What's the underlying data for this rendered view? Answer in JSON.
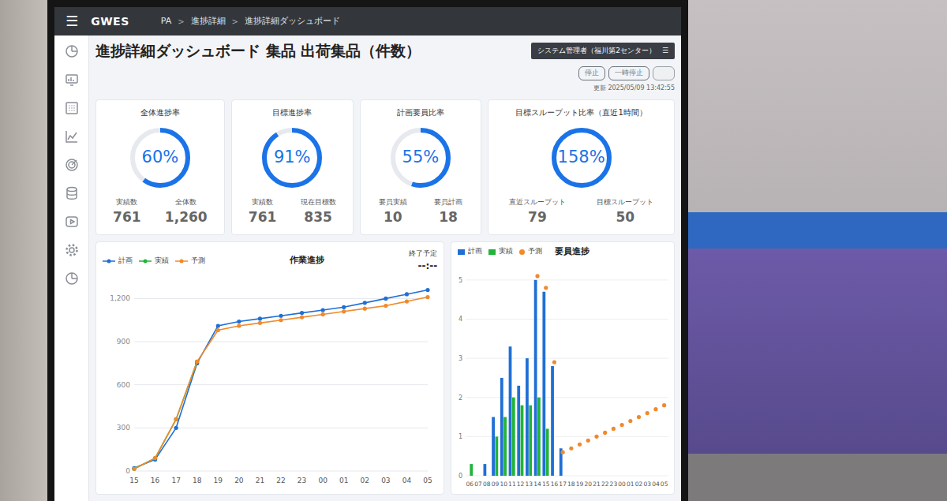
{
  "header": {
    "menu_icon": "☰",
    "logo": "GWES",
    "breadcrumbs": [
      "PA",
      "進捗詳細",
      "進捗詳細ダッシュボード"
    ],
    "separator": ">"
  },
  "page": {
    "title": "進捗詳細ダッシュボード 集品 出荷集品（件数）",
    "user": "システム管理者（福川第2センター）",
    "user_menu_icon": "☰"
  },
  "controls": {
    "buttons": [
      {
        "label": "停止",
        "disabled": false
      },
      {
        "label": "一時停止",
        "disabled": false
      },
      {
        "disabled": true
      }
    ],
    "updated": "更新 2025/05/09 13:42:55"
  },
  "gauges": [
    {
      "title": "全体進捗率",
      "value": "60%",
      "level": 0.6,
      "stats": [
        {
          "label": "実績数",
          "value": "761"
        },
        {
          "label": "全体数",
          "value": "1,260"
        }
      ]
    },
    {
      "title": "目標進捗率",
      "value": "91%",
      "level": 0.91,
      "stats": [
        {
          "label": "実績数",
          "value": "761"
        },
        {
          "label": "現在目標数",
          "value": "835"
        }
      ]
    },
    {
      "title": "計画要員比率",
      "value": "55%",
      "level": 0.55,
      "stats": [
        {
          "label": "要員実績",
          "value": "10"
        },
        {
          "label": "要員計画",
          "value": "18"
        }
      ]
    },
    {
      "title": "目標スループット比率（直近1時間）",
      "value": "158%",
      "level": 1.0,
      "stats": [
        {
          "label": "直近スループット",
          "value": "79"
        },
        {
          "label": "目標スループット",
          "value": "50"
        }
      ]
    }
  ],
  "charts": {
    "progress": {
      "title": "作業進捗",
      "end_label": "終了予定",
      "end_value": "--:--",
      "y_ticks": [
        "0",
        "300",
        "600",
        "900",
        "1,200"
      ],
      "x_labels": [
        "15",
        "16",
        "17",
        "18",
        "19",
        "20",
        "21",
        "22",
        "23",
        "00",
        "01",
        "02",
        "03",
        "04",
        "05"
      ],
      "series": [
        {
          "label": "計画",
          "color": "#1f6fd6",
          "values": [
            20,
            80,
            300,
            750,
            1010,
            1040,
            1060,
            1080,
            1100,
            1120,
            1140,
            1170,
            1200,
            1230,
            1260
          ]
        },
        {
          "label": "実績",
          "color": "#22b33a",
          "values": [
            15,
            90,
            360,
            761,
            null,
            null,
            null,
            null,
            null,
            null,
            null,
            null,
            null,
            null,
            null
          ]
        },
        {
          "label": "予測",
          "color": "#f08a2c",
          "values": [
            15,
            90,
            360,
            761,
            980,
            1010,
            1030,
            1050,
            1070,
            1090,
            1110,
            1130,
            1150,
            1180,
            1210
          ]
        }
      ]
    },
    "staffing": {
      "title": "要員進捗",
      "y_ticks": [
        "0",
        "1",
        "2",
        "3",
        "4",
        "5"
      ],
      "x_labels": [
        "06",
        "07",
        "08",
        "09",
        "10",
        "11",
        "12",
        "13",
        "14",
        "15",
        "16",
        "17",
        "18",
        "19",
        "20",
        "21",
        "22",
        "23",
        "00",
        "01",
        "02",
        "03",
        "04",
        "05"
      ],
      "series": [
        {
          "label": "計画",
          "color": "#1f6fd6",
          "kind": "bar",
          "values": [
            0,
            0,
            0.3,
            1.5,
            2.5,
            3.3,
            2.3,
            3.0,
            5.0,
            4.7,
            2.8,
            0.7,
            0,
            0,
            0,
            0,
            0,
            0,
            0,
            0,
            0,
            0,
            0,
            0
          ]
        },
        {
          "label": "実績",
          "color": "#22b33a",
          "kind": "bar",
          "values": [
            0.3,
            0,
            0,
            1.0,
            1.5,
            2.0,
            1.8,
            1.8,
            2.0,
            1.2,
            0,
            0,
            0,
            0,
            0,
            0,
            0,
            0,
            0,
            0,
            0,
            0,
            0,
            0
          ]
        },
        {
          "label": "予測",
          "color": "#f08a2c",
          "kind": "dot",
          "values": [
            null,
            null,
            null,
            null,
            null,
            null,
            null,
            null,
            5.1,
            4.8,
            2.9,
            0.6,
            0.7,
            0.8,
            0.9,
            1.0,
            1.1,
            1.2,
            1.3,
            1.4,
            1.5,
            1.6,
            1.7,
            1.8
          ]
        }
      ]
    }
  }
}
